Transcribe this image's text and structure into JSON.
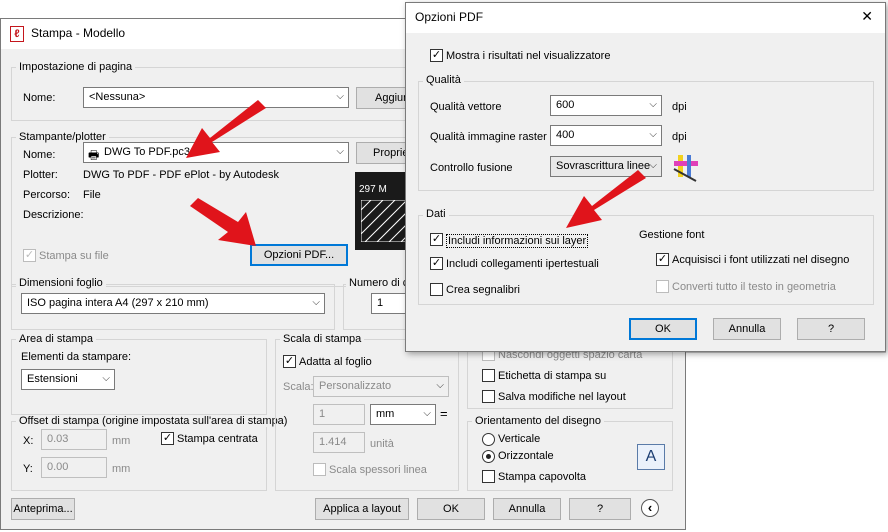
{
  "stampa": {
    "title": "Stampa - Modello",
    "page_setup": {
      "group": "Impostazione di pagina",
      "name_label": "Nome:",
      "name_value": "<Nessuna>",
      "add_button": "Aggiun"
    },
    "printer": {
      "group": "Stampante/plotter",
      "name_label": "Nome:",
      "name_value": "DWG To PDF.pc3",
      "properties_button": "Propriet",
      "plotter_label": "Plotter:",
      "plotter_value": "DWG To PDF - PDF ePlot - by Autodesk",
      "path_label": "Percorso:",
      "path_value": "File",
      "desc_label": "Descrizione:",
      "print_to_file": "Stampa su file",
      "pdf_options_button": "Opzioni PDF...",
      "preview_dim": "297 M"
    },
    "paper_size": {
      "group": "Dimensioni foglio",
      "value": "ISO pagina intera A4 (297 x 210 mm)"
    },
    "copies": {
      "group": "Numero di cop",
      "value": "1"
    },
    "plot_area": {
      "group": "Area di stampa",
      "what_label": "Elementi da stampare:",
      "what_value": "Estensioni"
    },
    "plot_offset": {
      "group": "Offset di stampa (origine impostata sull'area di stampa)",
      "x_label": "X:",
      "x_value": "0.03",
      "y_label": "Y:",
      "y_value": "0.00",
      "unit": "mm",
      "center": "Stampa centrata"
    },
    "plot_scale": {
      "group": "Scala di stampa",
      "fit": "Adatta al foglio",
      "scale_label": "Scala:",
      "scale_value": "Personalizzato",
      "num_value": "1",
      "unit_value": "mm",
      "eq": "=",
      "den_value": "1.414",
      "den_unit": "unità",
      "lineweights": "Scala spessori linea"
    },
    "options": {
      "hide": "Nascondi oggetti spazio carta",
      "stamp": "Etichetta di stampa su",
      "save": "Salva modifiche nel layout"
    },
    "orientation": {
      "group": "Orientamento del disegno",
      "portrait": "Verticale",
      "landscape": "Orizzontale",
      "upside": "Stampa capovolta",
      "icon_letter": "A"
    },
    "footer": {
      "preview": "Anteprima...",
      "apply": "Applica a layout",
      "ok": "OK",
      "cancel": "Annulla",
      "help": "?",
      "expand_icon": "‹"
    }
  },
  "pdf": {
    "title": "Opzioni PDF",
    "close_icon": "✕",
    "show_results": "Mostra i risultati nel visualizzatore",
    "quality": {
      "group": "Qualità",
      "vector_label": "Qualità vettore",
      "vector_value": "600",
      "raster_label": "Qualità immagine raster",
      "raster_value": "400",
      "merge_label": "Controllo fusione",
      "merge_value": "Sovrascrittura linee",
      "dpi": "dpi"
    },
    "data": {
      "group": "Dati",
      "layer_info": "Includi informazioni sui layer",
      "hyperlinks": "Includi collegamenti ipertestuali",
      "bookmarks": "Crea segnalibri"
    },
    "fonts": {
      "group": "Gestione font",
      "capture": "Acquisisci i font utilizzati nel disegno",
      "convert": "Converti tutto il testo in geometria"
    },
    "buttons": {
      "ok": "OK",
      "cancel": "Annulla",
      "help": "?"
    }
  },
  "colors": {
    "arrow": "#e0141b",
    "focus": "#0078d7"
  }
}
